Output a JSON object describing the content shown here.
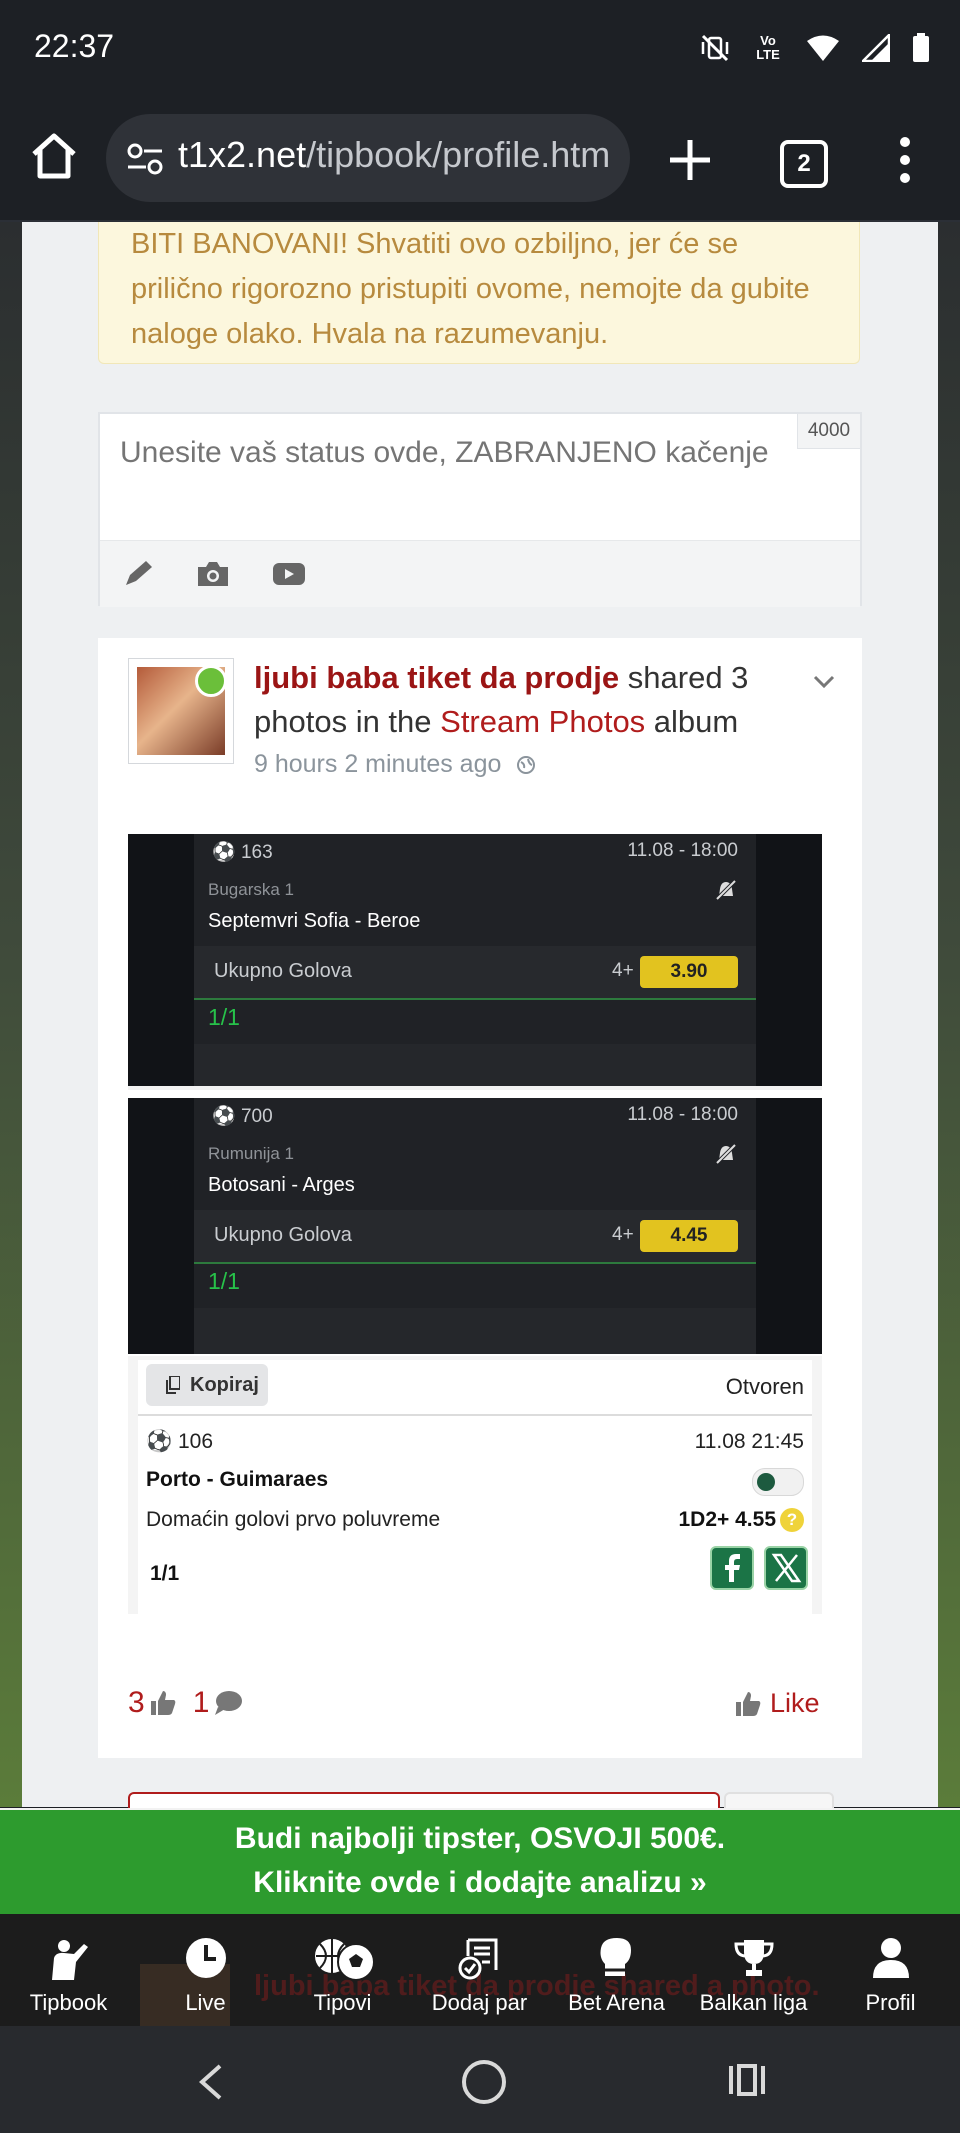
{
  "status_bar": {
    "time": "22:37",
    "icons": [
      "vibrate-off-icon",
      "volte-icon",
      "wifi-icon",
      "signal-icon",
      "battery-icon"
    ],
    "volte_label": "Vo LTE"
  },
  "browser": {
    "url_host": "t1x2.net",
    "url_path": "/tipbook/profile.htm",
    "tab_count": "2"
  },
  "warning": {
    "text": "BITI BANOVANI! Shvatiti ovo ozbiljno, jer će se prilično rigorozno pristupiti ovome, nemojte da gubite naloge olako. Hvala na razumevanju."
  },
  "composer": {
    "placeholder": "Unesite vaš status ovde, ZABRANJENO kačenje",
    "char_limit": "4000",
    "tools": [
      "pencil-icon",
      "camera-icon",
      "youtube-icon"
    ]
  },
  "post": {
    "username": "ljubi baba tiket da prodje",
    "action_text": " shared 3 photos in the ",
    "album_name": "Stream Photos",
    "album_suffix": " album",
    "time": "9 hours 2 minutes ago",
    "likes": "3",
    "comments": "1",
    "like_label": "Like"
  },
  "photos": [
    {
      "event_id": "163",
      "datetime": "11.08  -  18:00",
      "league": "Bugarska 1",
      "match": "Septemvri Sofia - Beroe",
      "market": "Ukupno Golova",
      "line": "4+",
      "odds": "3.90",
      "result": "1/1"
    },
    {
      "event_id": "700",
      "datetime": "11.08  -  18:00",
      "league": "Rumunija 1",
      "match": "Botosani - Arges",
      "market": "Ukupno Golova",
      "line": "4+",
      "odds": "4.45",
      "result": "1/1"
    }
  ],
  "photo3": {
    "copy_label": "Kopiraj",
    "status": "Otvoren",
    "event_id": "106",
    "datetime": "11.08 21:45",
    "match": "Porto - Guimaraes",
    "market": "Domaćin golovi prvo poluvreme",
    "pick": "1D2+ 4.55",
    "help": "?",
    "result": "1/1"
  },
  "promo": {
    "line1": "Budi najbolji tipster, OSVOJI 500€.",
    "line2": "Kliknite ovde i dodajte analizu »"
  },
  "behind_post": {
    "text": "ljubi baba tiket da prodje shared a photo."
  },
  "bottom_nav": [
    {
      "label": "Tipbook",
      "icon": "tipster-icon"
    },
    {
      "label": "Live",
      "icon": "clock-icon"
    },
    {
      "label": "Tipovi",
      "icon": "balls-icon"
    },
    {
      "label": "Dodaj par",
      "icon": "ticket-add-icon"
    },
    {
      "label": "Bet Arena",
      "icon": "boxing-glove-icon"
    },
    {
      "label": "Balkan liga",
      "icon": "trophy-icon"
    },
    {
      "label": "Profil",
      "icon": "user-icon"
    }
  ],
  "colors": {
    "accent_red": "#9b1515",
    "promo_green": "#2d9b2e",
    "odds_yellow": "#e2c31f",
    "warning_bg": "#fcf7dd"
  }
}
